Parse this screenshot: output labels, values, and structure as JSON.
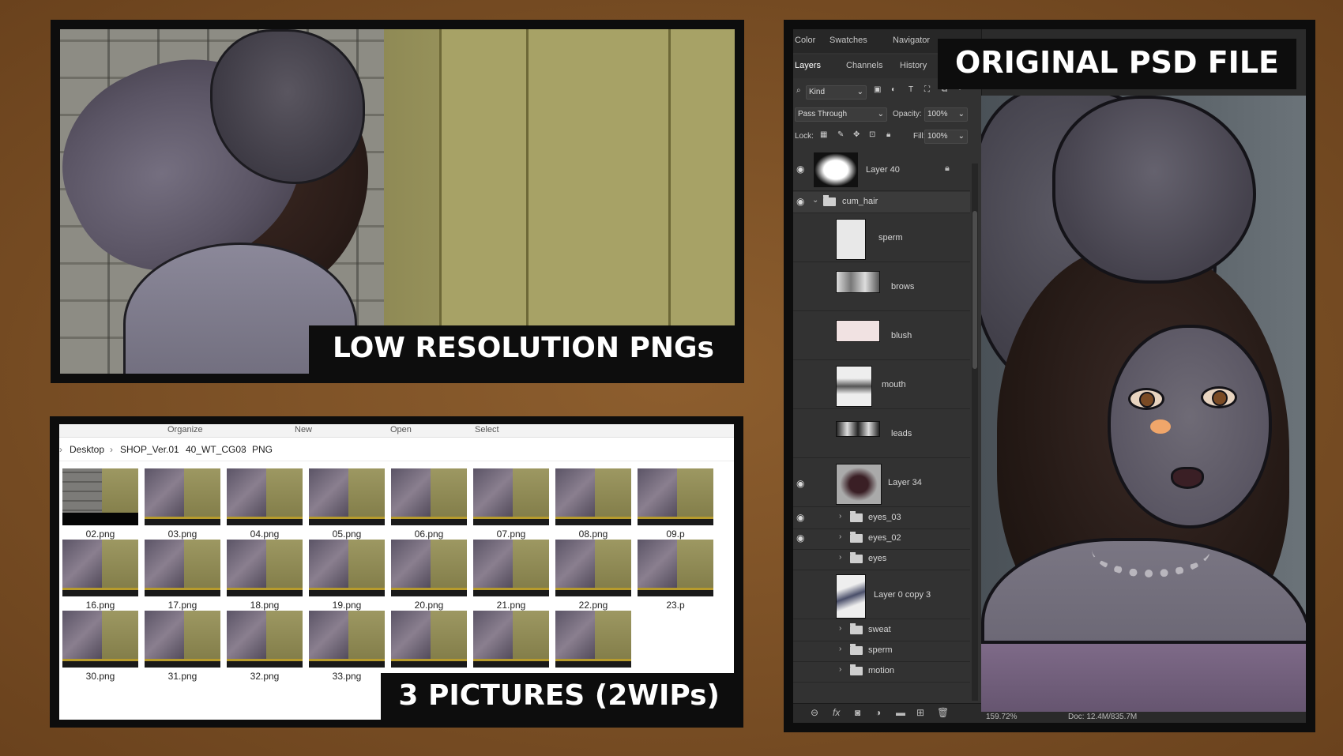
{
  "captions": {
    "low_res": "LOW RESOLUTION PNGs",
    "pictures": "3 PICTURES (2WIPs)",
    "psd": "ORIGINAL PSD FILE"
  },
  "explorer": {
    "toolbar": [
      "Organize",
      "New",
      "Open",
      "Select"
    ],
    "breadcrumb": [
      "Desktop",
      "SHOP_Ver.01",
      "40_WT_CG03",
      "PNG"
    ],
    "files": [
      [
        "02.png",
        "03.png",
        "04.png",
        "05.png",
        "06.png",
        "07.png",
        "08.png",
        "09.p"
      ],
      [
        "16.png",
        "17.png",
        "18.png",
        "19.png",
        "20.png",
        "21.png",
        "22.png",
        "23.p"
      ],
      [
        "30.png",
        "31.png",
        "32.png",
        "33.png",
        "",
        "",
        "",
        ""
      ]
    ]
  },
  "photoshop": {
    "tabs_top": [
      "Color",
      "Swatches",
      "Navigator"
    ],
    "tabs_second": [
      "Layers",
      "Channels",
      "History"
    ],
    "filter_kind": "Kind",
    "blend_mode": "Pass Through",
    "opacity_label": "Opacity:",
    "opacity_value": "100%",
    "lock_label": "Lock:",
    "fill_label": "Fill:",
    "fill_value": "100%",
    "layers": {
      "layer40": "Layer 40",
      "cum_hair": "cum_hair",
      "sperm": "sperm",
      "brows": "brows",
      "blush": "blush",
      "mouth": "mouth",
      "leads": "leads",
      "layer34": "Layer 34",
      "eyes03": "eyes_03",
      "eyes02": "eyes_02",
      "eyes": "eyes",
      "layer0copy3": "Layer 0 copy 3",
      "sweat": "sweat",
      "sperm2": "sperm",
      "motion": "motion"
    },
    "status_zoom": "159.72%",
    "status_doc": "Doc: 12.4M/835.7M",
    "bottom_icons": [
      "link-icon",
      "fx-icon",
      "mask-icon",
      "adjustment-icon",
      "group-icon",
      "new-layer-icon",
      "trash-icon"
    ]
  }
}
